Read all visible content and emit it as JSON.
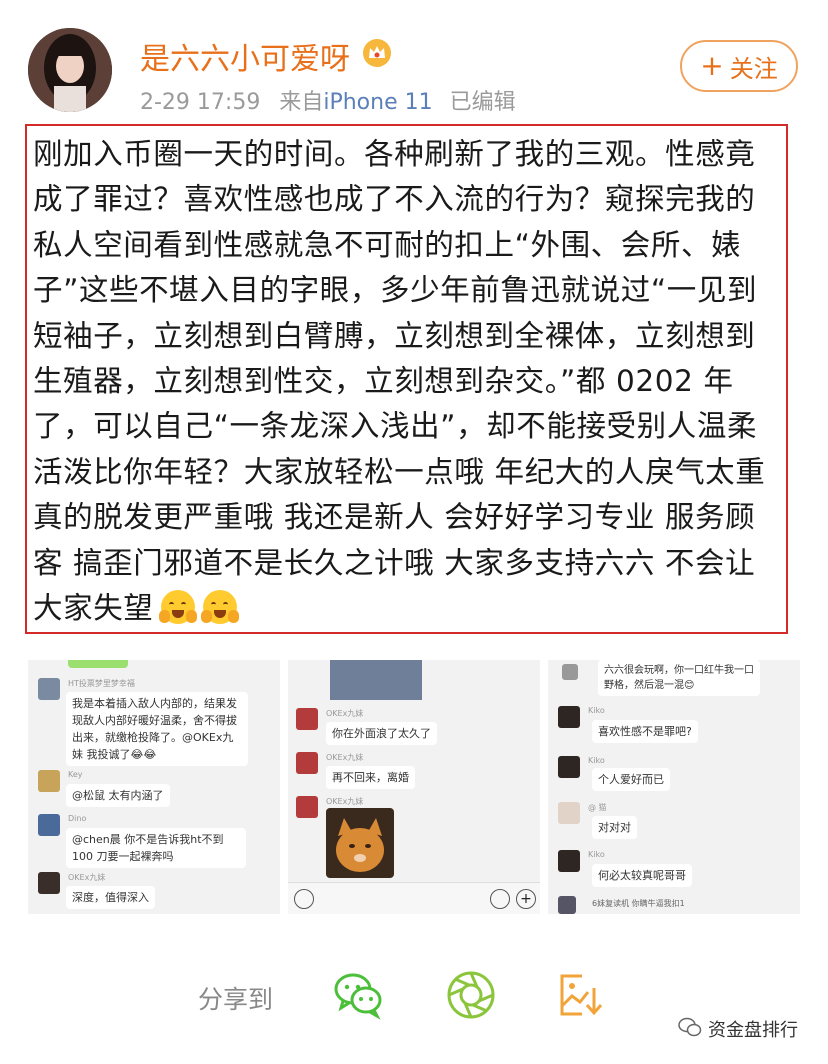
{
  "header": {
    "username": "是六六小可爱呀",
    "date": "2-29 17:59",
    "from_prefix": "来自",
    "source": "iPhone 11",
    "edited": "已编辑",
    "follow_label": "关注"
  },
  "post": {
    "text": "刚加入币圈一天的时间。各种刷新了我的三观。性感竟成了罪过？喜欢性感也成了不入流的行为？窥探完我的私人空间看到性感就急不可耐的扣上“外围、会所、婊子”这些不堪入目的字眼，多少年前鲁迅就说过“一见到短袖子，立刻想到白臂膊，立刻想到全裸体，立刻想到生殖器，立刻想到性交，立刻想到杂交。”都 0202 年了，可以自己“一条龙深入浅出”，却不能接受别人温柔活泼比你年轻？大家放轻松一点哦 年纪大的人戾气太重真的脱发更严重哦  我还是新人 会好好学习专业 服务顾客 搞歪门邪道不是长久之计哦 大家多支持六六 不会让大家失望"
  },
  "screenshots": {
    "shot1": {
      "messages": [
        {
          "name": "HT投票梦里梦幸福",
          "text": "我是本着插入敌人内部的，结果发现敌人内部好暖好温柔，舍不得拔出来，就缴枪投降了。@OKEx九妹 我投诚了😂😂"
        },
        {
          "name": "Key",
          "text": "@松鼠  太有内涵了"
        },
        {
          "name": "Dino",
          "text": "@chen晨  你不是告诉我ht不到100 刀要一起裸奔吗"
        },
        {
          "name": "OKEx九妹",
          "text": "深度，值得深入"
        }
      ]
    },
    "shot2": {
      "messages": [
        {
          "name": "OKEx九妹",
          "text": "你在外面浪了太久了"
        },
        {
          "name": "OKEx九妹",
          "text": "再不回来，离婚"
        },
        {
          "name": "OKEx九妹",
          "text": ""
        }
      ]
    },
    "shot3": {
      "messages": [
        {
          "name": "",
          "text": "六六很会玩啊，你一口红牛我一口野格，然后混一混😊"
        },
        {
          "name": "Kiko",
          "text": "喜欢性感不是罪吧?"
        },
        {
          "name": "Kiko",
          "text": "个人爱好而已"
        },
        {
          "name": "@ 猫",
          "text": "对对对"
        },
        {
          "name": "Kiko",
          "text": "何必太较真呢哥哥"
        },
        {
          "name": "",
          "text": "6妹复读机 你瞒牛逼我扣1"
        }
      ]
    }
  },
  "share": {
    "label": "分享到",
    "icons": [
      "wechat-icon",
      "moments-icon",
      "save-image-icon"
    ]
  },
  "watermark": {
    "text": "资金盘排行"
  },
  "colors": {
    "username": "#e8701a",
    "highlight_border": "#d42a2a",
    "wechat_green": "#4cbf3a",
    "moments_green": "#8ac53c",
    "save_orange": "#f2a43a"
  }
}
